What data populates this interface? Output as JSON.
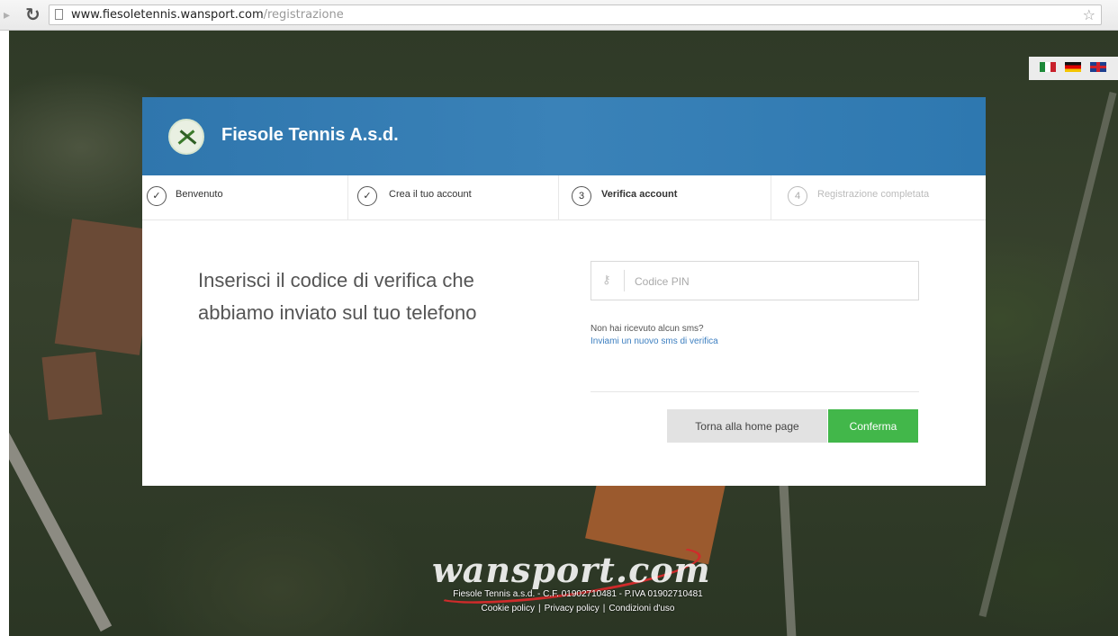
{
  "browser": {
    "url_host": "www.fiesoletennis.wansport.com",
    "url_path": "/registrazione"
  },
  "header": {
    "club_name": "Fiesole Tennis A.s.d."
  },
  "languages": [
    {
      "code": "it",
      "icon": "italy-flag-icon"
    },
    {
      "code": "de",
      "icon": "germany-flag-icon"
    },
    {
      "code": "en",
      "icon": "uk-flag-icon"
    }
  ],
  "steps": [
    {
      "marker": "✓",
      "label": "Benvenuto",
      "state": "done"
    },
    {
      "marker": "✓",
      "label": "Crea il tuo account",
      "state": "done"
    },
    {
      "marker": "3",
      "label": "Verifica account",
      "state": "active"
    },
    {
      "marker": "4",
      "label": "Registrazione completata",
      "state": "pending"
    }
  ],
  "main": {
    "instructions": "Inserisci il codice di verifica che abbiamo inviato sul tuo telefono",
    "pin_placeholder": "Codice PIN",
    "pin_value": "",
    "no_sms_text": "Non hai ricevuto alcun sms?",
    "resend_link": "Inviami un nuovo sms di verifica",
    "back_button": "Torna alla home page",
    "confirm_button": "Conferma"
  },
  "footer": {
    "brand": "wansport.com",
    "info": "Fiesole Tennis a.s.d. - C.F. 01902710481 - P.IVA 01902710481",
    "links": [
      "Cookie policy",
      "Privacy policy",
      "Condizioni d'uso"
    ],
    "separator": "|"
  },
  "colors": {
    "header_blue": "#2f76ad",
    "confirm_green": "#42b74a",
    "link_blue": "#3d7fc0"
  }
}
